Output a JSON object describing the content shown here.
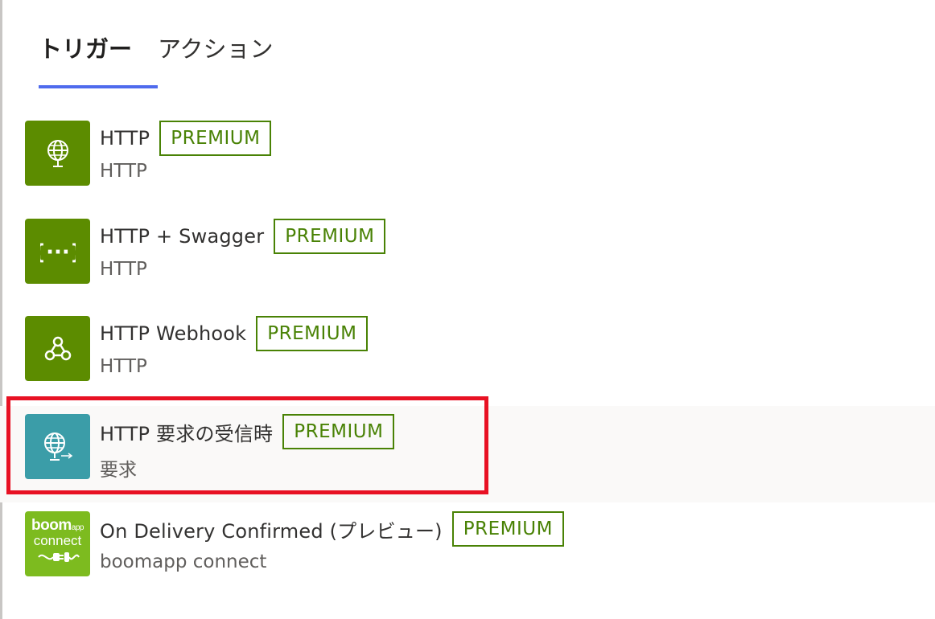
{
  "tabs": {
    "triggers": "トリガー",
    "actions": "アクション"
  },
  "items": [
    {
      "title": "HTTP",
      "badge": "PREMIUM",
      "subtitle": "HTTP",
      "icon": "globe-icon",
      "color": "#5c8c00"
    },
    {
      "title": "HTTP + Swagger",
      "badge": "PREMIUM",
      "subtitle": "HTTP",
      "icon": "braces-icon",
      "color": "#5c8c00"
    },
    {
      "title": "HTTP Webhook",
      "badge": "PREMIUM",
      "subtitle": "HTTP",
      "icon": "webhook-icon",
      "color": "#5c8c00"
    },
    {
      "title": "HTTP 要求の受信時",
      "badge": "PREMIUM",
      "subtitle": "要求",
      "icon": "globe-arrow-icon",
      "color": "#3b9da8"
    },
    {
      "title": "On Delivery Confirmed (プレビュー)",
      "badge": "PREMIUM",
      "subtitle": "boomapp connect",
      "icon": "boomapp-logo",
      "color": "#7dbb1f"
    }
  ],
  "logo": {
    "line1": "boom",
    "line1_small": "app",
    "line2": "connect"
  },
  "colors": {
    "accent": "#4f6bed",
    "premium": "#498205",
    "highlight": "#e81123"
  }
}
